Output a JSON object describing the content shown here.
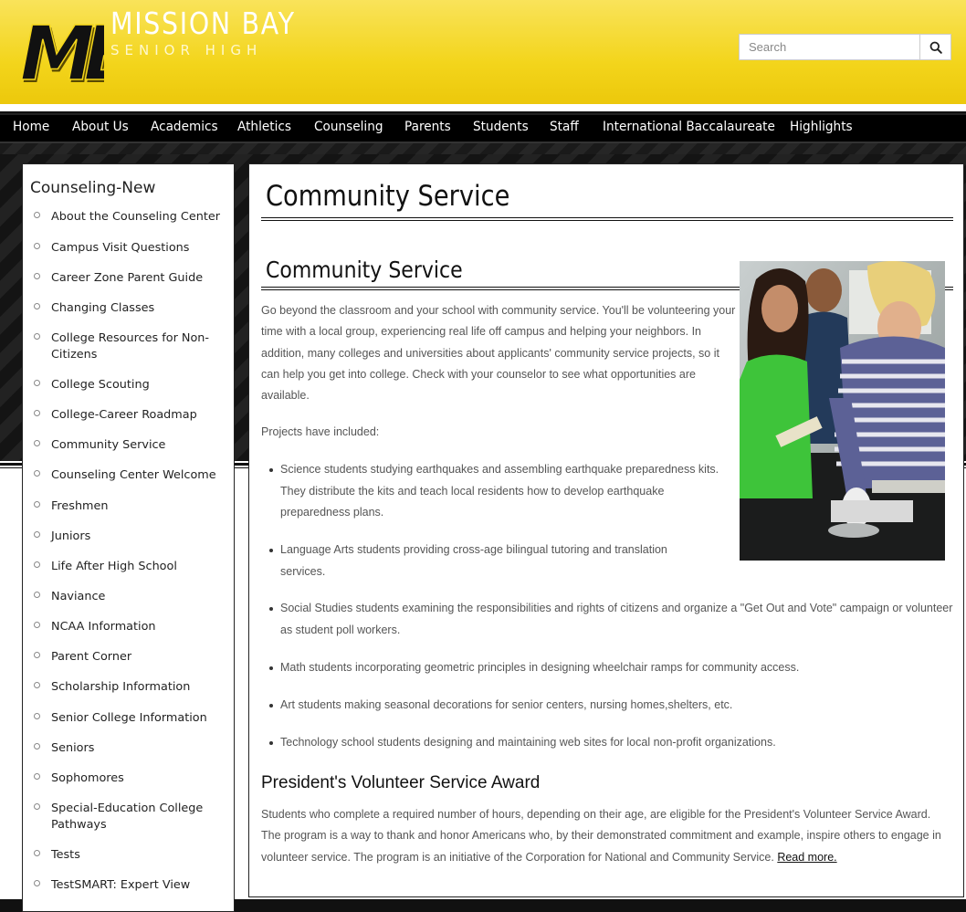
{
  "brand": {
    "logo_monogram": "MB",
    "name": "MISSION BAY",
    "subtitle": "SENIOR HIGH",
    "colors": {
      "gold": "#f3d51c",
      "black": "#000000",
      "text_gray": "#555555"
    }
  },
  "search": {
    "placeholder": "Search",
    "icon": "search-icon"
  },
  "nav": {
    "items": [
      "Home",
      "About Us",
      "Academics",
      "Athletics",
      "Counseling",
      "Parents",
      "Students",
      "Staff",
      "International Baccalaureate",
      "Highlights"
    ]
  },
  "sidebar": {
    "title": "Counseling-New",
    "items": [
      "About the Counseling Center",
      "Campus Visit Questions",
      "Career Zone Parent Guide",
      "Changing Classes",
      "College Resources for Non-Citizens",
      "College Scouting",
      "College-Career Roadmap",
      "Community Service",
      "Counseling Center Welcome",
      "Freshmen",
      "Juniors",
      "Life After High School",
      "Naviance",
      "NCAA Information",
      "Parent Corner",
      "Scholarship Information",
      "Senior College Information",
      "Seniors",
      "Sophomores",
      "Special-Education College Pathways",
      "Tests",
      "TestSMART: Expert View"
    ]
  },
  "main": {
    "page_title": "Community Service",
    "section_title": "Community Service",
    "intro": "Go beyond the classroom and your school with community service. You'll be volunteering your time with a local group, experiencing real life off campus and helping your neighbors. In addition, many colleges and universities about applicants' community service projects, so it can help you get into college. Check with your counselor to see what opportunities are available.",
    "projects_label": "Projects have included:",
    "projects": [
      "Science students studying earthquakes and assembling earthquake preparedness kits. They distribute the kits and teach local residents how to develop earthquake preparedness plans.",
      "Language Arts students providing cross-age bilingual tutoring and translation services.",
      "Social Studies students examining the responsibilities and rights of citizens and organize a \"Get Out and Vote\" campaign or volunteer as student poll workers.",
      "Math students incorporating geometric principles in designing wheelchair ramps for community access.",
      "Art students making seasonal decorations for senior centers, nursing homes,shelters, etc.",
      "Technology school students designing and maintaining web sites for local non-profit organizations."
    ],
    "award_title": "President's Volunteer Service Award",
    "award_text": "Students who complete a required number of hours, depending on their age, are eligible for the President's Volunteer Service Award. The program is a way to thank and honor Americans who, by their demonstrated commitment and example, inspire others to engage in volunteer service. The program is an initiative of the Corporation for National and Community Service.",
    "read_more": "Read more."
  }
}
